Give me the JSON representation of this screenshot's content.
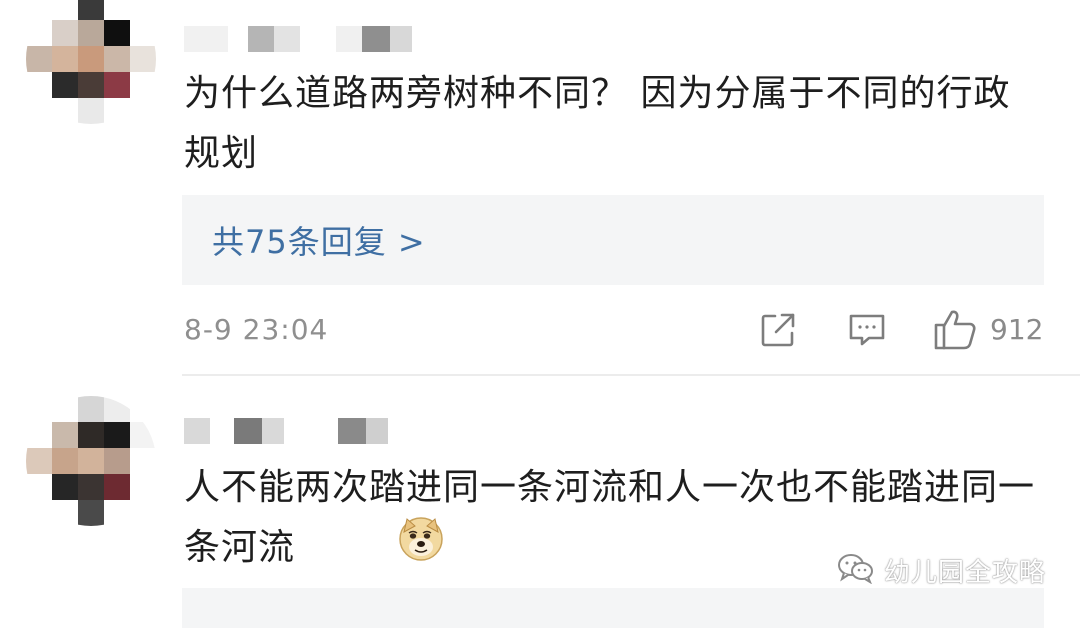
{
  "comments": [
    {
      "text": "为什么道路两旁树种不同？ 因为分属于不同的行政规划",
      "replies_label": "共75条回复 >",
      "time": "8-9 23:04",
      "likes": "912"
    },
    {
      "text": "人不能两次踏进同一条河流和人一次也不能踏进同一条河流"
    }
  ],
  "icons": {
    "share": "share-icon",
    "comment": "comment-icon",
    "like": "thumbs-up-icon",
    "emoji": "doge-emoji-icon",
    "watermark_logo": "wechat-icon"
  },
  "watermark": {
    "text": "幼儿园全攻略"
  },
  "colors": {
    "link": "#3f6fa3",
    "meta": "#8f8f8f",
    "reply_box": "#f4f5f6"
  }
}
